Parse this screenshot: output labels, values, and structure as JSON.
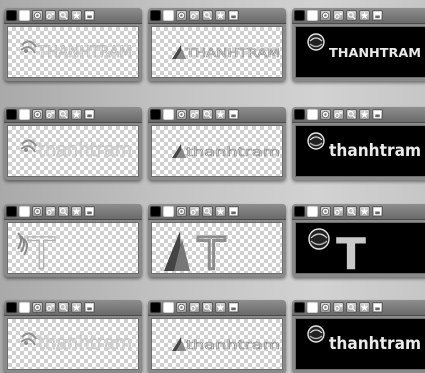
{
  "toolbar_icons": [
    "bg-black-swatch",
    "bg-white-swatch",
    "color-wheel-icon",
    "gear-toggle-icon",
    "magnify-icon",
    "star-icon",
    "save-icon"
  ],
  "wordmarks": {
    "upper": "THANHTRAM",
    "lower": "thanhtram",
    "monogram": "T"
  },
  "rows": [
    {
      "variant": "wordmark-upper-outline",
      "text_key": "upper"
    },
    {
      "variant": "wordmark-lower",
      "text_key": "lower"
    },
    {
      "variant": "monogram",
      "text_key": "monogram"
    },
    {
      "variant": "wordmark-lower",
      "text_key": "lower"
    }
  ],
  "columns": [
    {
      "background": "checker",
      "mark": "wave-swirl"
    },
    {
      "background": "checker",
      "mark": "triangle-fan"
    },
    {
      "background": "dark",
      "mark": "globe"
    }
  ],
  "colors": {
    "silver_text": "#d4d4d4",
    "dark_text": "#eaeaea",
    "outline_text": "#b7b7b7"
  }
}
